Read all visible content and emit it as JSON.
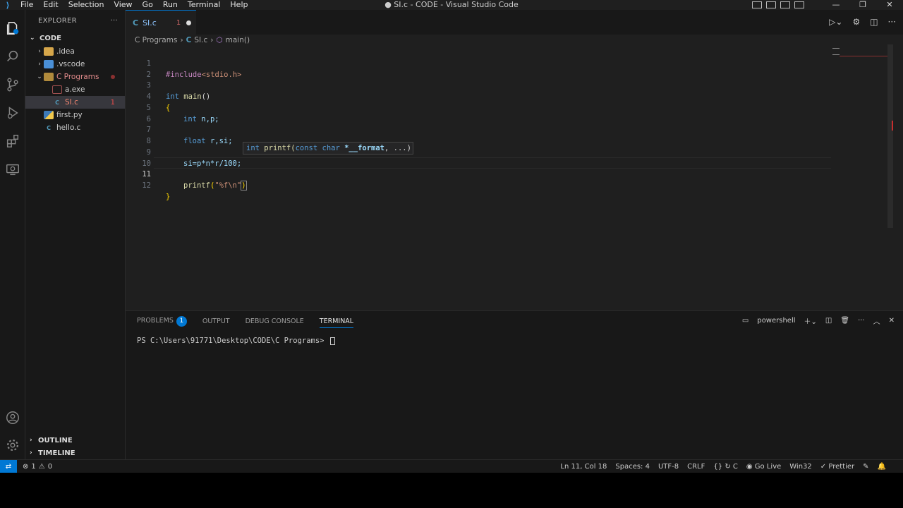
{
  "window": {
    "title": "● SI.c - CODE - Visual Studio Code",
    "menu": [
      "File",
      "Edit",
      "Selection",
      "View",
      "Go",
      "Run",
      "Terminal",
      "Help"
    ]
  },
  "sidebar": {
    "header": "EXPLORER",
    "more": "···",
    "root": "CODE",
    "items": [
      {
        "label": ".idea",
        "icon": "folder-idea-icon"
      },
      {
        "label": ".vscode",
        "icon": "folder-vscode-icon"
      },
      {
        "label": "C Programs",
        "icon": "folder-open-icon"
      },
      {
        "label": "a.exe",
        "icon": "exe-file-icon"
      },
      {
        "label": "SI.c",
        "icon": "c-file-icon",
        "badge": "1"
      },
      {
        "label": "first.py",
        "icon": "python-file-icon"
      },
      {
        "label": "hello.c",
        "icon": "c-file-icon"
      }
    ],
    "outline": "OUTLINE",
    "timeline": "TIMELINE"
  },
  "tab": {
    "label": "SI.c",
    "count": "1",
    "icon": "C"
  },
  "breadcrumb": {
    "folder": "C Programs",
    "file": "SI.c",
    "symbol": "main()",
    "c": "C"
  },
  "code": {
    "line_numbers": [
      "1",
      "2",
      "3",
      "4",
      "5",
      "6",
      "7",
      "8",
      "9",
      "10",
      "11",
      "12"
    ],
    "l1": {
      "pp": "#include",
      "rest": "<stdio.h>"
    },
    "l3": {
      "kw": "int",
      "fn": "main",
      "rest": "()"
    },
    "l4": "{",
    "l5": {
      "kw": "int",
      "rest": "n,p;"
    },
    "l7": {
      "kw": "float",
      "rest": "r,si;"
    },
    "l9": {
      "rest": "si=p*n*r/100;"
    },
    "l11": {
      "fn": "printf",
      "open": "(",
      "str": "\"%f\\n\"",
      "close": ")"
    },
    "l12": "}"
  },
  "hover": {
    "ret": "int",
    "sig": "printf(",
    "kw": "const char",
    "param": "*__format",
    "rest": ", ...)"
  },
  "panel": {
    "tabs": [
      "PROBLEMS",
      "OUTPUT",
      "DEBUG CONSOLE",
      "TERMINAL"
    ],
    "problems_badge": "1",
    "shell": "powershell",
    "prompt": "PS C:\\Users\\91771\\Desktop\\CODE\\C Programs> "
  },
  "status": {
    "errors": "1",
    "warnings": "0",
    "position": "Ln 11, Col 18",
    "spaces": "Spaces: 4",
    "encoding": "UTF-8",
    "eol": "CRLF",
    "language": "C",
    "golive": "Go Live",
    "platform": "Win32",
    "prettier": "Prettier"
  },
  "colors": {
    "accent": "#0078d4",
    "editor_bg": "#1f1f1f",
    "sidebar_bg": "#181818"
  }
}
